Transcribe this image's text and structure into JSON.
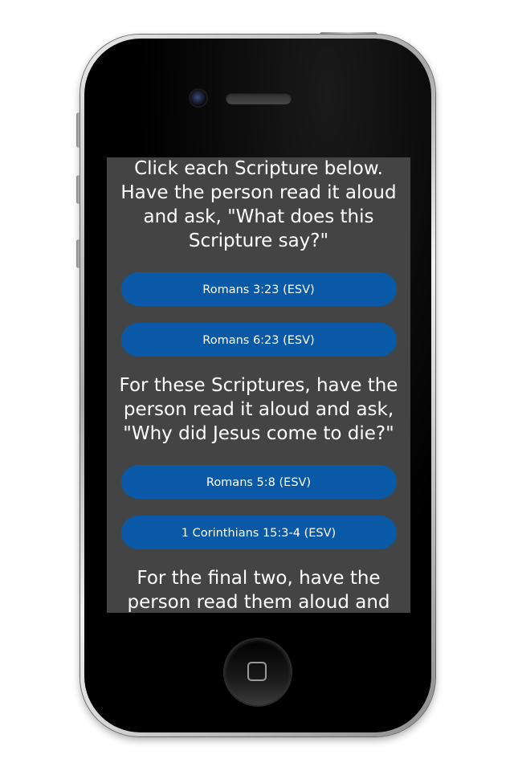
{
  "screen": {
    "intro_text": "Click each Scripture below. Have the person read it aloud and ask, \"What does this Scripture say?\"",
    "group_1_buttons": [
      "Romans 3:23 (ESV)",
      "Romans 6:23 (ESV)"
    ],
    "middle_text": "For these Scriptures, have the person read it aloud and ask, \"Why did Jesus come to die?\"",
    "group_2_buttons": [
      "Romans 5:8 (ESV)",
      "1 Corinthians 15:3-4 (ESV)"
    ],
    "final_text": "For the final two, have the person read them aloud and ask, \"What does this"
  },
  "colors": {
    "screen_background": "#444444",
    "button_background": "#0a59a6",
    "text": "#ffffff"
  }
}
